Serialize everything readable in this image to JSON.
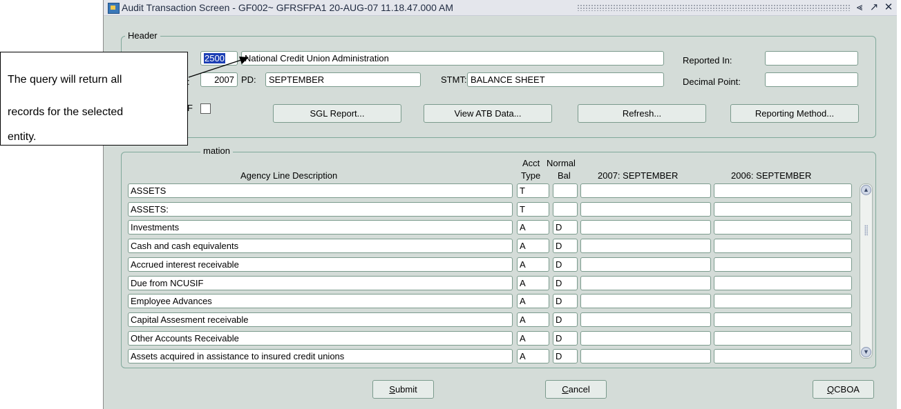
{
  "window": {
    "title": "Audit Transaction Screen - GF002~ GFRSFPA1 20-AUG-07 11.18.47.000 AM",
    "controls": [
      "⪡",
      "↗",
      "✕"
    ]
  },
  "header": {
    "legend": "Header",
    "entity_code": "2500",
    "entity_name": "National Credit Union Administration",
    "fy_label_partial": ":",
    "fy_value": "2007",
    "pd_label": "PD:",
    "pd_value": "SEPTEMBER",
    "stmt_label": "STMT:",
    "stmt_value": "BALANCE SHEET",
    "reported_in_label": "Reported In:",
    "reported_in_value": "",
    "decimal_point_label": "Decimal Point:",
    "decimal_point_value": "",
    "checkbox_label_partial": "F",
    "buttons": {
      "sgl_report": "SGL Report...",
      "view_atb": "View ATB Data...",
      "refresh": "Refresh...",
      "reporting_method": "Reporting Method..."
    }
  },
  "audit": {
    "legend_visible": "mation",
    "columns": {
      "description": "Agency Line Description",
      "acct": "Acct",
      "type": "Type",
      "normal": "Normal",
      "bal": "Bal",
      "cur_period": "2007: SEPTEMBER",
      "prev_period": "2006: SEPTEMBER"
    },
    "rows": [
      {
        "description": "ASSETS",
        "type": "T",
        "bal": "",
        "cur": "",
        "prev": ""
      },
      {
        "description": "ASSETS:",
        "type": "T",
        "bal": "",
        "cur": "",
        "prev": ""
      },
      {
        "description": "Investments",
        "type": "A",
        "bal": "D",
        "cur": "",
        "prev": ""
      },
      {
        "description": "Cash and cash equivalents",
        "type": "A",
        "bal": "D",
        "cur": "",
        "prev": ""
      },
      {
        "description": "Accrued interest receivable",
        "type": "A",
        "bal": "D",
        "cur": "",
        "prev": ""
      },
      {
        "description": "Due from NCUSIF",
        "type": "A",
        "bal": "D",
        "cur": "",
        "prev": ""
      },
      {
        "description": "Employee Advances",
        "type": "A",
        "bal": "D",
        "cur": "",
        "prev": ""
      },
      {
        "description": "Capital Assesment receivable",
        "type": "A",
        "bal": "D",
        "cur": "",
        "prev": ""
      },
      {
        "description": "Other Accounts Receivable",
        "type": "A",
        "bal": "D",
        "cur": "",
        "prev": ""
      },
      {
        "description": "Assets acquired in assistance to insured credit unions",
        "type": "A",
        "bal": "D",
        "cur": "",
        "prev": ""
      }
    ]
  },
  "footer": {
    "submit_mnemonic": "S",
    "submit_rest": "ubmit",
    "cancel_mnemonic": "C",
    "cancel_rest": "ancel",
    "qcboa_mnemonic": "Q",
    "qcboa_rest": "CBOA"
  },
  "callout": {
    "line1": "The query will return all",
    "line2": "records for the selected",
    "line3": "entity."
  }
}
